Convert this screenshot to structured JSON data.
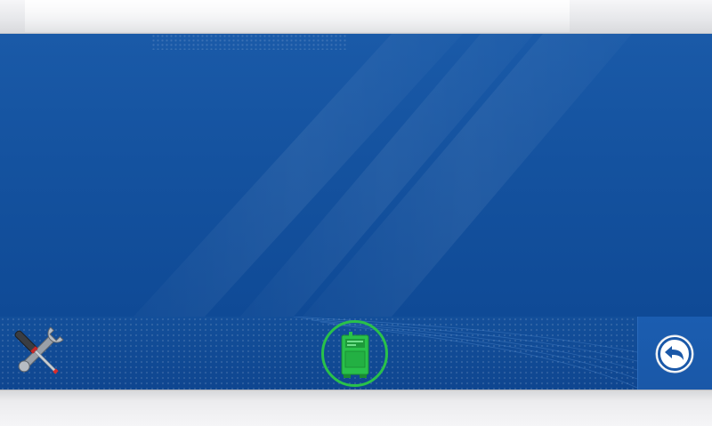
{
  "screen": {
    "theme": {
      "panel_blue": "#1553a0",
      "accent_green": "#29c14a",
      "bar_gray": "#e6e7ea"
    }
  },
  "toolbar": {
    "tools_button": {
      "icon": "wrench-screwdriver-icon"
    },
    "device_button": {
      "icon": "machine-icon",
      "status_color": "#29c14a"
    },
    "back_button": {
      "icon": "back-arrow-icon"
    }
  }
}
